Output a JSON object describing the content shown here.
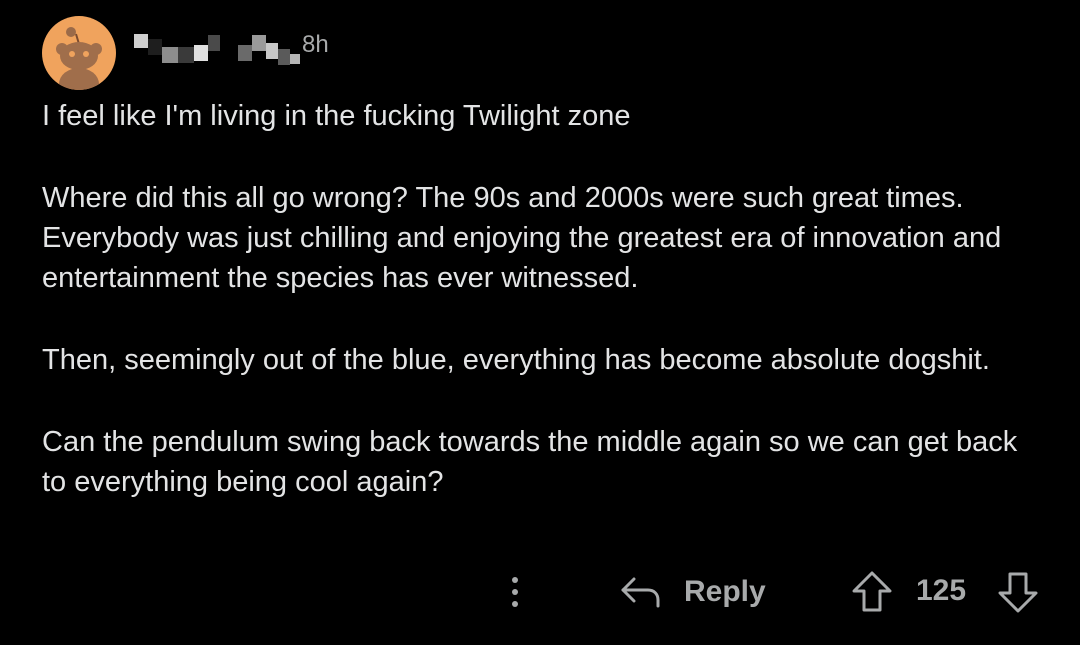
{
  "comment": {
    "timestamp": "8h",
    "paragraphs": [
      "I feel like I'm living in the fucking Twilight zone",
      "Where did this all go wrong? The 90s and 2000s were such great times. Everybody was just chilling and enjoying the greatest era of innovation and entertainment the species has ever witnessed.",
      "Then, seemingly out of the blue, everything has become absolute dogshit.",
      "Can the pendulum swing back towards the middle again so we can get back to everything being cool again?"
    ],
    "avatar_icon": "reddit-snoo-avatar-icon",
    "avatar_color": "#f0a35d"
  },
  "actions": {
    "more_icon": "more-vertical-icon",
    "reply_icon": "reply-arrow-icon",
    "reply_label": "Reply",
    "upvote_icon": "upvote-arrow-icon",
    "score": "125",
    "downvote_icon": "downvote-arrow-icon"
  }
}
